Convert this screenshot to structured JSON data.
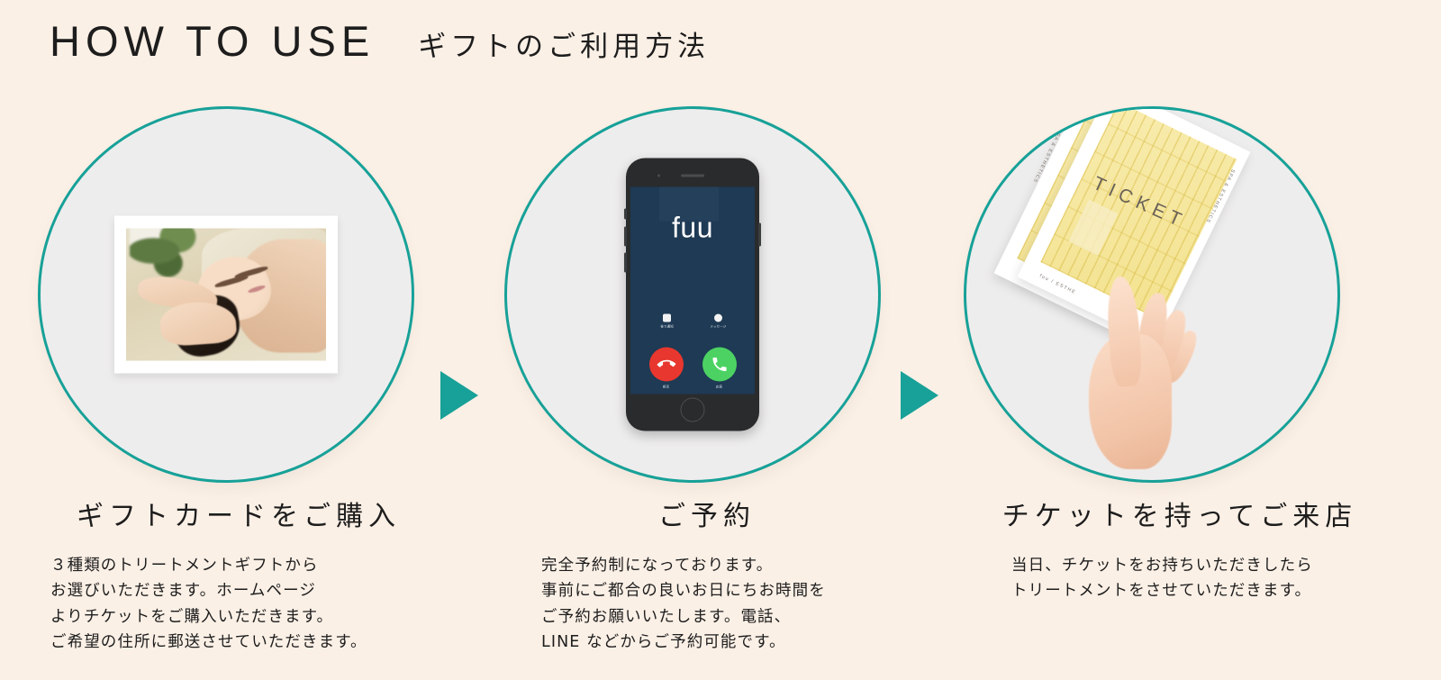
{
  "theme": {
    "background": "#fbf0e6",
    "accent_teal": "#17a198",
    "circle_fill": "#eeeded",
    "text": "#1d1d1d",
    "phone_screen": "#1e3a54",
    "decline_red": "#e8372e",
    "answer_green": "#4cd263",
    "ticket_yellow": "#f3e28f"
  },
  "header": {
    "title_en": "HOW TO USE",
    "title_jp": "ギフトのご利用方法"
  },
  "steps": [
    {
      "id": "step-1-purchase",
      "title": "ギフトカードをご購入",
      "body_lines": [
        "３種類のトリートメントギフトから",
        "お選びいただきます。ホームページ",
        "よりチケットをご購入いただきます。",
        "ご希望の住所に郵送させていただきます。"
      ],
      "visual": "facial-treatment-photo"
    },
    {
      "id": "step-2-reserve",
      "title": "ご予約",
      "body_lines": [
        "完全予約制になっております。",
        "事前にご都合の良いお日にちお時間を",
        "ご予約お願いいたします。電話、",
        "LINE などからご予約可能です。"
      ],
      "visual": "smartphone-incoming-call"
    },
    {
      "id": "step-3-visit",
      "title": "チケットを持ってご来店",
      "body_lines": [
        "当日、チケットをお持ちいただきしたら",
        "トリートメントをさせていただきます。"
      ],
      "visual": "hand-holding-ticket"
    }
  ],
  "phone": {
    "caller_name": "fuu",
    "actions": [
      {
        "icon": "clock-icon",
        "label": "後で通知"
      },
      {
        "icon": "message-icon",
        "label": "メッセージ"
      }
    ],
    "buttons": [
      {
        "icon": "phone-down-icon",
        "label": "拒否",
        "color": "#e8372e"
      },
      {
        "icon": "phone-up-icon",
        "label": "応答",
        "color": "#4cd263"
      }
    ]
  },
  "ticket": {
    "word": "TICKET",
    "sub_right": "SPA & ESTHETICS",
    "sub_bottom": "fuu / ESTHE",
    "sub_back": "SPA & ESTHETICS"
  },
  "arrows": {
    "label": "next-step-arrow"
  }
}
